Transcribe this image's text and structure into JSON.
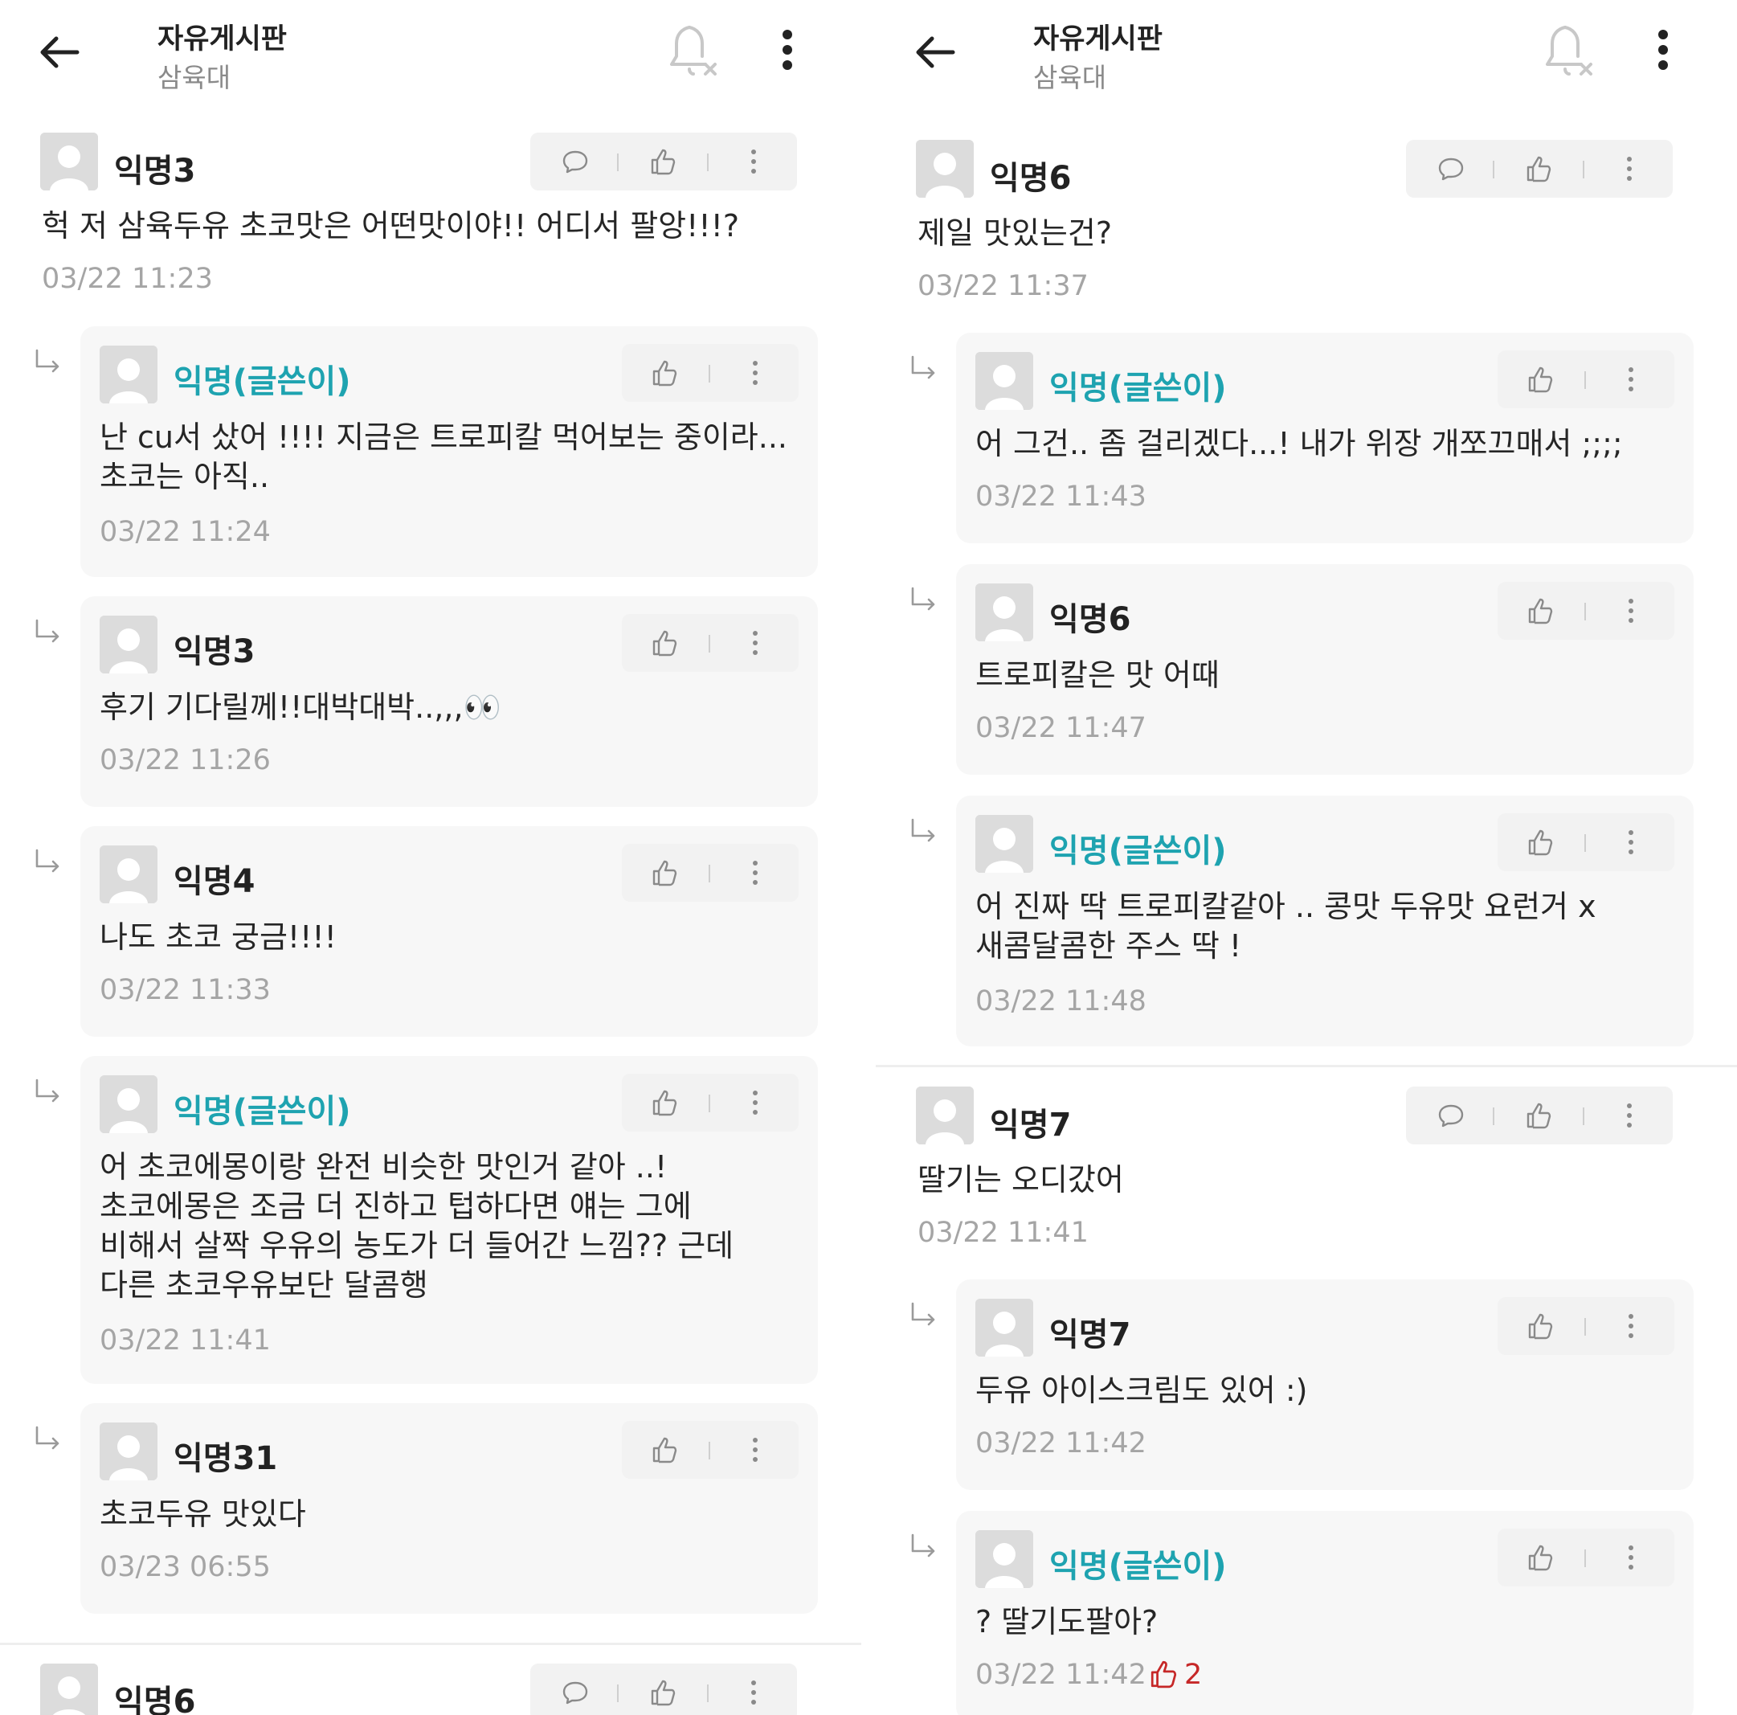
{
  "header": {
    "title": "자유게시판",
    "subtitle": "삼육대"
  },
  "left": {
    "comments": [
      {
        "nick": "익명3",
        "text": "헉 저 삼육두유 초코맛은 어떤맛이야!! 어디서 팔앙!!!?",
        "time": "03/22 11:23"
      },
      {
        "nick": "익명6"
      }
    ],
    "replies": [
      {
        "nick": "익명(글쓴이)",
        "text": "난 cu서 샀어 !!!! 지금은 트로피칼 먹어보는 중이라...\n초코는 아직..",
        "time": "03/22 11:24"
      },
      {
        "nick": "익명3",
        "text": "후기 기다릴께!!대박대박..,,,👀",
        "time": "03/22 11:26"
      },
      {
        "nick": "익명4",
        "text": "나도 초코 궁금!!!!",
        "time": "03/22 11:33"
      },
      {
        "nick": "익명(글쓴이)",
        "text": "어 초코에몽이랑 완전 비슷한 맛인거 같아 ..!\n초코에몽은 조금 더 진하고 텁하다면 얘는 그에\n비해서 살짝 우유의 농도가 더 들어간 느낌?? 근데\n다른 초코우유보단 달콤행",
        "time": "03/22 11:41"
      },
      {
        "nick": "익명31",
        "text": "초코두유 맛있다",
        "time": "03/23 06:55"
      }
    ]
  },
  "right": {
    "comments": [
      {
        "nick": "익명6",
        "text": "제일 맛있는건?",
        "time": "03/22 11:37"
      },
      {
        "nick": "익명7",
        "text": "딸기는 오디갔어",
        "time": "03/22 11:41"
      }
    ],
    "replies": [
      {
        "nick": "익명(글쓴이)",
        "text": "어 그건.. 좀 걸리겠다...! 내가 위장 개쪼끄매서 ;;;;",
        "time": "03/22 11:43"
      },
      {
        "nick": "익명6",
        "text": "트로피칼은 맛 어때",
        "time": "03/22 11:47"
      },
      {
        "nick": "익명(글쓴이)",
        "text": "어 진짜 딱 트로피칼같아 .. 콩맛 두유맛 요런거 x\n새콤달콤한 주스 딱 !",
        "time": "03/22 11:48"
      },
      {
        "nick": "익명7",
        "text": "두유 아이스크림도 있어 :)",
        "time": "03/22 11:42"
      },
      {
        "nick": "익명(글쓴이)",
        "text": "? 딸기도팔아?",
        "time": "03/22 11:42",
        "likes": "2"
      }
    ]
  },
  "colors": {
    "op_nick": "#1ea3b0",
    "like_count": "#c62828",
    "reply_bg": "#f7f7f7",
    "action_bg": "#f2f2f2"
  },
  "icons": [
    "back-arrow-icon",
    "bell-off-icon",
    "more-vertical-icon",
    "comment-bubble-icon",
    "thumbs-up-icon",
    "reply-arrow-icon",
    "avatar-icon"
  ]
}
